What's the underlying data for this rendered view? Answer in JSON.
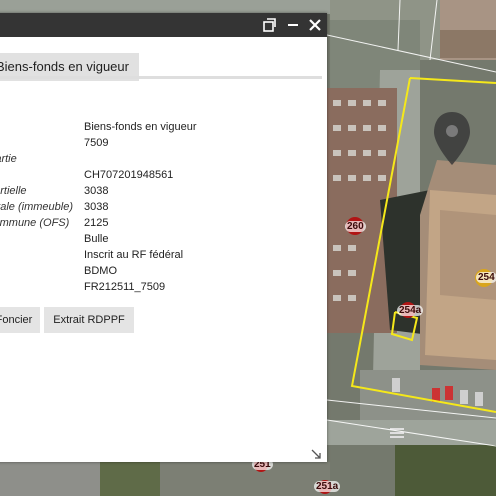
{
  "panel": {
    "tab_label": "Biens-fonds en vigueur",
    "rows": [
      {
        "label": "",
        "value": "Biens-fonds en vigueur"
      },
      {
        "label": "",
        "value": "7509"
      },
      {
        "label": "Partie",
        "value": ""
      },
      {
        "label": "",
        "value": "CH707201948561"
      },
      {
        "label": "partielle",
        "value": "3038"
      },
      {
        "label": "totale (immeuble)",
        "value": "3038"
      },
      {
        "label": "commune (OFS)",
        "value": "2125"
      },
      {
        "label": "",
        "value": "Bulle"
      },
      {
        "label": "",
        "value": "Inscrit au RF fédéral"
      },
      {
        "label": "",
        "value": "BDMO"
      },
      {
        "label": "",
        "value": "FR212511_7509"
      }
    ],
    "buttons": {
      "foncier": "Foncier",
      "rdppf": "Extrait RDPPF"
    }
  },
  "map_labels": [
    "260",
    "254",
    "254a",
    "251",
    "251a"
  ],
  "colors": {
    "selection": "#f5e81a",
    "titlebar": "#343434",
    "marker": "#b11515"
  }
}
